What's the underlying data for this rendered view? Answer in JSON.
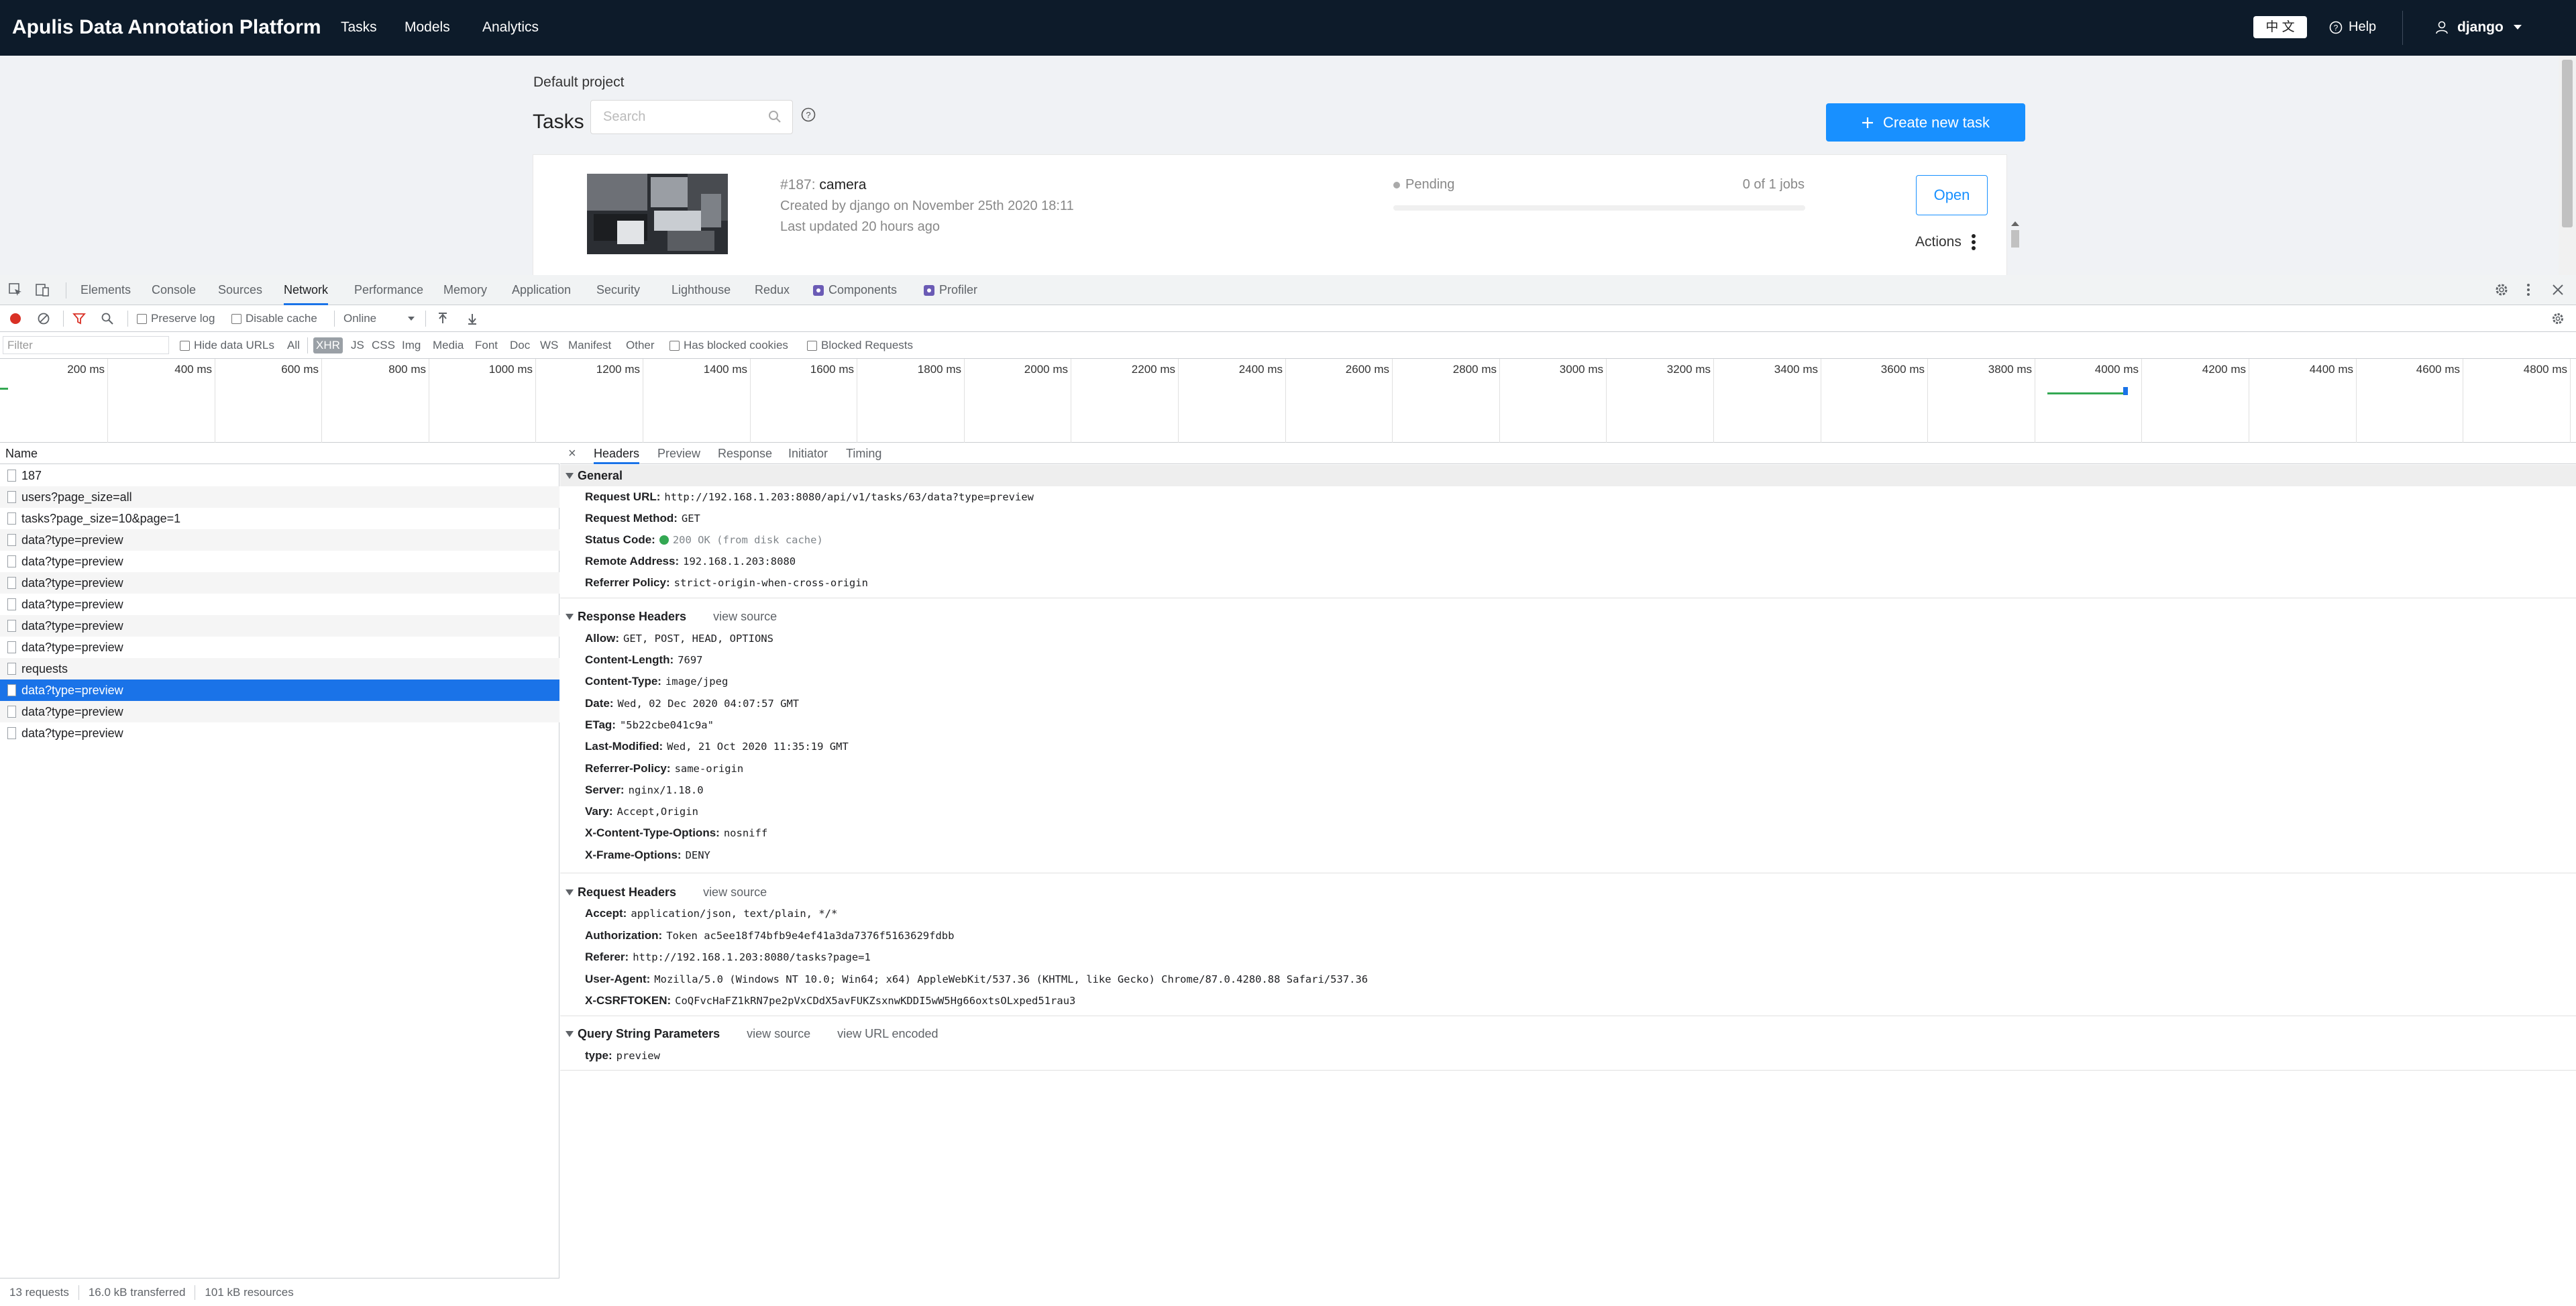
{
  "app": {
    "brand": "Apulis Data Annotation Platform",
    "nav": [
      "Tasks",
      "Models",
      "Analytics"
    ],
    "lang": "中 文",
    "help": "Help",
    "user": "django"
  },
  "page": {
    "project": "Default project",
    "title": "Tasks",
    "search_placeholder": "Search",
    "create_label": "Create new task",
    "task": {
      "id": "#187:",
      "name": "camera",
      "created": "Created by django on November 25th 2020 18:11",
      "updated": "Last updated 20 hours ago",
      "status": "Pending",
      "jobs": "0 of 1 jobs",
      "progress": 0,
      "open_label": "Open",
      "actions_label": "Actions"
    }
  },
  "devtools": {
    "tabs": [
      "Elements",
      "Console",
      "Sources",
      "Network",
      "Performance",
      "Memory",
      "Application",
      "Security",
      "Lighthouse",
      "Redux",
      "Components",
      "Profiler"
    ],
    "active_tab": "Network",
    "toolbar": {
      "preserve_log": "Preserve log",
      "disable_cache": "Disable cache",
      "throttle": "Online"
    },
    "filter": {
      "placeholder": "Filter",
      "hide_data_urls": "Hide data URLs",
      "types": [
        "All",
        "XHR",
        "JS",
        "CSS",
        "Img",
        "Media",
        "Font",
        "Doc",
        "WS",
        "Manifest",
        "Other"
      ],
      "selected_type": "XHR",
      "has_blocked_cookies": "Has blocked cookies",
      "blocked_requests": "Blocked Requests"
    },
    "timeline_ticks": [
      "200 ms",
      "400 ms",
      "600 ms",
      "800 ms",
      "1000 ms",
      "1200 ms",
      "1400 ms",
      "1600 ms",
      "1800 ms",
      "2000 ms",
      "2200 ms",
      "2400 ms",
      "2600 ms",
      "2800 ms",
      "3000 ms",
      "3200 ms",
      "3400 ms",
      "3600 ms",
      "3800 ms",
      "4000 ms",
      "4200 ms",
      "4400 ms",
      "4600 ms",
      "4800 ms"
    ],
    "requests_header": "Name",
    "requests": [
      "187",
      "users?page_size=all",
      "tasks?page_size=10&page=1",
      "data?type=preview",
      "data?type=preview",
      "data?type=preview",
      "data?type=preview",
      "data?type=preview",
      "data?type=preview",
      "requests",
      "data?type=preview",
      "data?type=preview",
      "data?type=preview"
    ],
    "selected_request_index": 10,
    "summary": {
      "requests": "13 requests",
      "transferred": "16.0 kB transferred",
      "resources": "101 kB resources"
    },
    "detail_tabs": [
      "Headers",
      "Preview",
      "Response",
      "Initiator",
      "Timing"
    ],
    "general": {
      "title": "General",
      "rows": [
        {
          "k": "Request URL:",
          "v": "http://192.168.1.203:8080/api/v1/tasks/63/data?type=preview"
        },
        {
          "k": "Request Method:",
          "v": "GET"
        },
        {
          "k": "Status Code:",
          "v": "200 OK (from disk cache)"
        },
        {
          "k": "Remote Address:",
          "v": "192.168.1.203:8080"
        },
        {
          "k": "Referrer Policy:",
          "v": "strict-origin-when-cross-origin"
        }
      ]
    },
    "response_headers": {
      "title": "Response Headers",
      "view_source": "view source",
      "rows": [
        {
          "k": "Allow:",
          "v": "GET, POST, HEAD, OPTIONS"
        },
        {
          "k": "Content-Length:",
          "v": "7697"
        },
        {
          "k": "Content-Type:",
          "v": "image/jpeg"
        },
        {
          "k": "Date:",
          "v": "Wed, 02 Dec 2020 04:07:57 GMT"
        },
        {
          "k": "ETag:",
          "v": "\"5b22cbe041c9a\""
        },
        {
          "k": "Last-Modified:",
          "v": "Wed, 21 Oct 2020 11:35:19 GMT"
        },
        {
          "k": "Referrer-Policy:",
          "v": "same-origin"
        },
        {
          "k": "Server:",
          "v": "nginx/1.18.0"
        },
        {
          "k": "Vary:",
          "v": "Accept,Origin"
        },
        {
          "k": "X-Content-Type-Options:",
          "v": "nosniff"
        },
        {
          "k": "X-Frame-Options:",
          "v": "DENY"
        }
      ]
    },
    "request_headers": {
      "title": "Request Headers",
      "view_source": "view source",
      "rows": [
        {
          "k": "Accept:",
          "v": "application/json, text/plain, */*"
        },
        {
          "k": "Authorization:",
          "v": "Token ac5ee18f74bfb9e4ef41a3da7376f5163629fdbb"
        },
        {
          "k": "Referer:",
          "v": "http://192.168.1.203:8080/tasks?page=1"
        },
        {
          "k": "User-Agent:",
          "v": "Mozilla/5.0 (Windows NT 10.0; Win64; x64) AppleWebKit/537.36 (KHTML, like Gecko) Chrome/87.0.4280.88 Safari/537.36"
        },
        {
          "k": "X-CSRFTOKEN:",
          "v": "CoQFvcHaFZ1kRN7pe2pVxCDdX5avFUKZsxnwKDDI5wW5Hg66oxtsOLxped51rau3"
        }
      ]
    },
    "query_params": {
      "title": "Query String Parameters",
      "view_source": "view source",
      "view_url_encoded": "view URL encoded",
      "rows": [
        {
          "k": "type:",
          "v": "preview"
        }
      ]
    }
  },
  "colors": {
    "header_bg": "#0d1b2a",
    "accent": "#1890ff",
    "devtools_selected": "#1a73e8",
    "record_red": "#d93025"
  }
}
